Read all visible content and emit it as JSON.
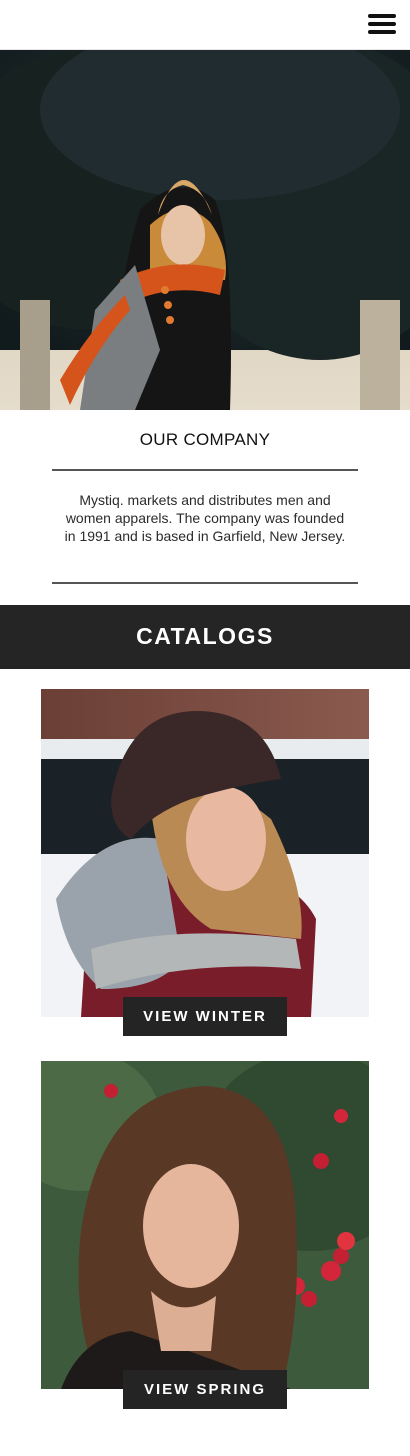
{
  "header": {
    "menu_icon": "hamburger-menu-icon"
  },
  "hero": {
    "image_alt": ""
  },
  "company": {
    "title": "OUR COMPANY",
    "description": "Mystiq. markets and distributes men and women apparels. The company was founded in 1991 and is based in Garfield, New Jersey."
  },
  "catalogs": {
    "title": "CATALOGS",
    "items": [
      {
        "button_label": "VIEW WINTER"
      },
      {
        "button_label": "VIEW SPRING"
      }
    ]
  },
  "colors": {
    "dark_bar": "#252525",
    "button_bg": "#242424",
    "rule": "#555555",
    "text": "#2b2b2b"
  }
}
